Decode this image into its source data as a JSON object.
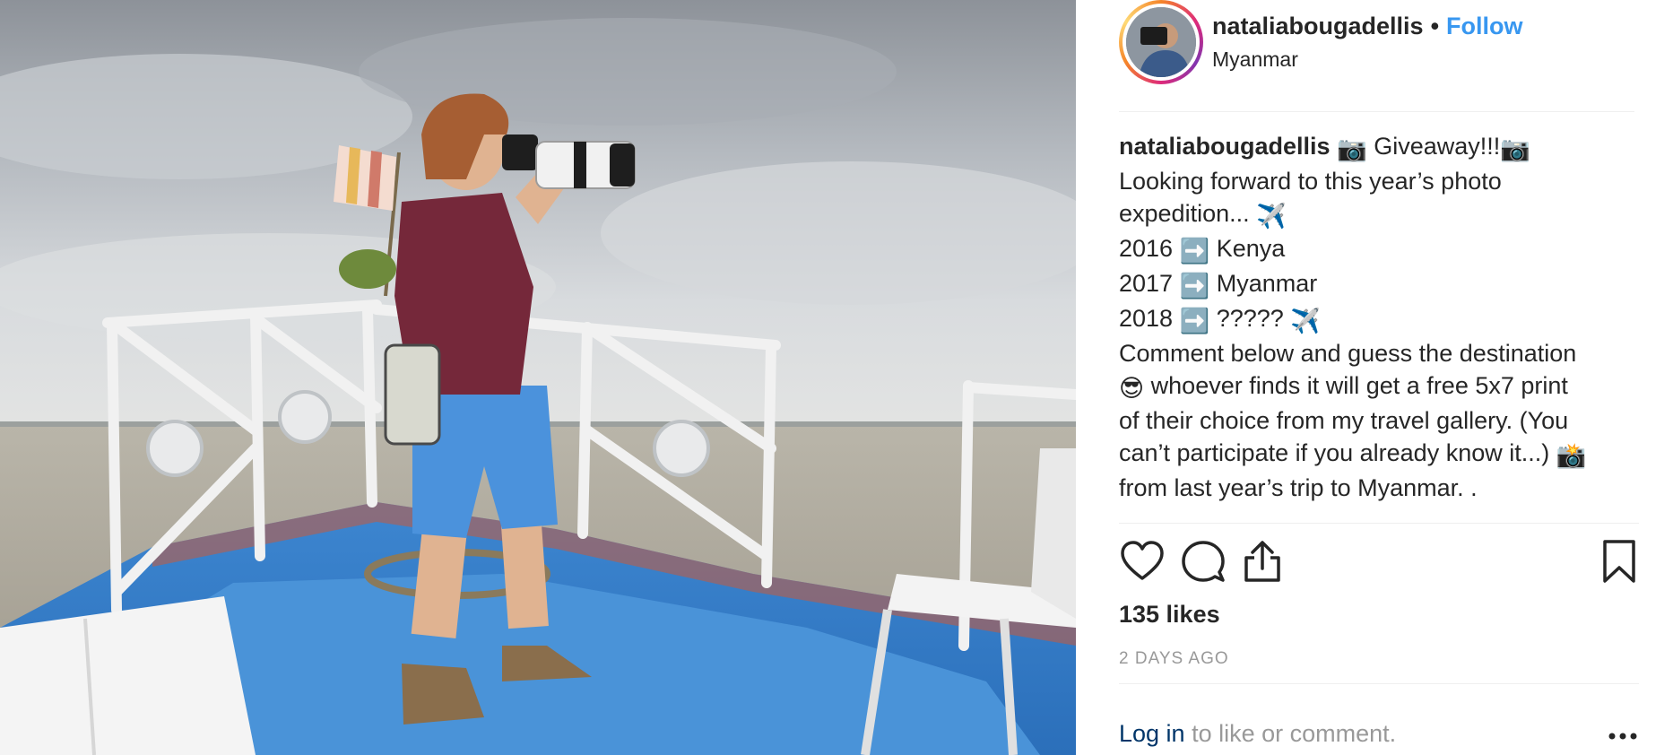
{
  "photo": {
    "alt_subject": "photographer on boat deck"
  },
  "header": {
    "username": "nataliabougadellis",
    "separator": "•",
    "follow_label": "Follow",
    "location": "Myanmar",
    "avatar_icon": "profile-avatar"
  },
  "caption": {
    "username": "nataliabougadellis",
    "line1_text": "Giveaway!!!",
    "line2": "Looking forward to this year’s photo",
    "line3_text": "expedition... ",
    "line4_year": "2016",
    "line4_place": "Kenya",
    "line5_year": "2017",
    "line5_place": "Myanmar",
    "line6_year": "2018",
    "line6_place": "?????",
    "line7": "Comment below and guess the destination",
    "line8_text": "whoever finds it will get a free 5x7 print",
    "line9": "of their choice from my travel gallery. (You",
    "line10": "can’t participate if you already know it...)",
    "line11": "from last year’s trip to Myanmar. .",
    "line12": ".",
    "emoji_camera": "📷",
    "emoji_airplane": "✈️",
    "emoji_arrow": "➡️",
    "emoji_sunglasses": "😎",
    "emoji_camera_flash": "📸"
  },
  "actions": {
    "like_icon": "heart-icon",
    "comment_icon": "comment-icon",
    "share_icon": "share-icon",
    "save_icon": "bookmark-icon"
  },
  "likes": {
    "label": "135 likes"
  },
  "timestamp": {
    "label": "2 DAYS AGO"
  },
  "footer": {
    "login_link": "Log in",
    "login_rest": " to like or comment.",
    "more_icon": "more-options-icon"
  },
  "colors": {
    "follow": "#3897f0",
    "text": "#262626",
    "muted": "#999999",
    "link_dark": "#003569",
    "divider": "#efefef"
  }
}
